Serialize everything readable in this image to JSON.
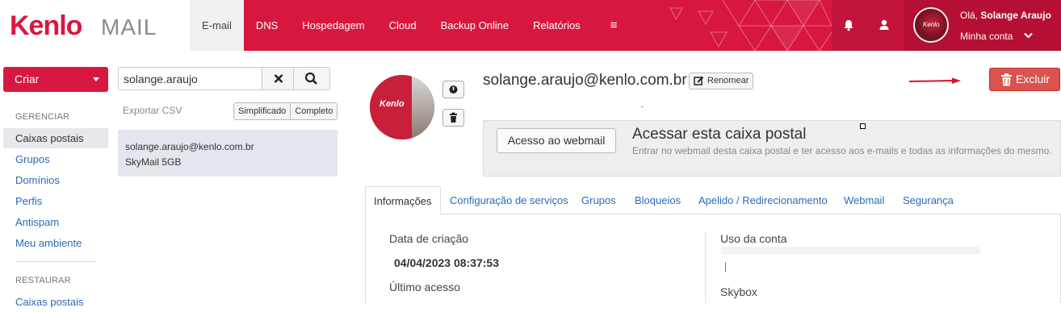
{
  "brand": {
    "logo_primary": "Kenlo",
    "logo_secondary": "MAIL",
    "accent_color": "#d8173f"
  },
  "nav": {
    "items": [
      {
        "label": "E-mail",
        "active": true
      },
      {
        "label": "DNS"
      },
      {
        "label": "Hospedagem"
      },
      {
        "label": "Cloud"
      },
      {
        "label": "Backup Online"
      },
      {
        "label": "Relatórios"
      },
      {
        "label": "≡"
      }
    ],
    "icons": [
      "bell-icon",
      "user-icon"
    ]
  },
  "account": {
    "greeting": "Olá,",
    "name": "Solange Araujo",
    "menu_label": "Minha conta",
    "avatar_text": "Kenlo"
  },
  "sidebar": {
    "create_label": "Criar",
    "manage_header": "GERENCIAR",
    "manage_items": [
      {
        "label": "Caixas postais",
        "active": true
      },
      {
        "label": "Grupos"
      },
      {
        "label": "Domínios"
      },
      {
        "label": "Perfis"
      },
      {
        "label": "Antispam"
      },
      {
        "label": "Meu ambiente"
      }
    ],
    "restore_header": "RESTAURAR",
    "restore_items": [
      {
        "label": "Caixas postais"
      }
    ]
  },
  "search": {
    "value": "solange.araujo",
    "export_label": "Exportar CSV",
    "view_simple": "Simplificado",
    "view_full": "Completo",
    "results": [
      {
        "email": "solange.araujo@kenlo.com.br",
        "plan": "SkyMail 5GB"
      }
    ]
  },
  "mailbox": {
    "email": "solange.araujo@kenlo.com.br",
    "rename_label": "Renomear",
    "delete_label": "Excluir",
    "avatar_text": "Kenlo"
  },
  "webmail": {
    "button_label": "Acesso ao webmail",
    "title": "Acessar esta caixa postal",
    "description": "Entrar no webmail desta caixa postal e ter acesso aos e-mails e todas as informações do mesmo."
  },
  "tabs": [
    {
      "label": "Informações",
      "active": true
    },
    {
      "label": "Configuração de serviços"
    },
    {
      "label": "Grupos"
    },
    {
      "label": "Bloqueios"
    },
    {
      "label": "Apelido / Redirecionamento"
    },
    {
      "label": "Webmail"
    },
    {
      "label": "Segurança"
    }
  ],
  "info": {
    "created_label": "Data de criação",
    "created_value": "04/04/2023 08:37:53",
    "last_access_label": "Último acesso",
    "usage_label": "Uso da conta",
    "skybox_label": "Skybox"
  }
}
